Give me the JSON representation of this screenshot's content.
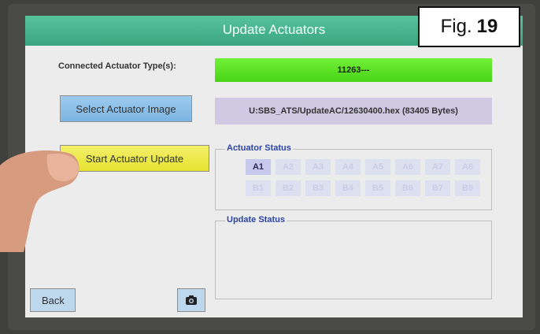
{
  "window": {
    "title": "Update Actuators"
  },
  "figure_label": {
    "prefix": "Fig.",
    "number": "19"
  },
  "connected": {
    "label": "Connected Actuator Type(s):",
    "value": "11263---"
  },
  "buttons": {
    "select_image": "Select Actuator Image",
    "start_update": "Start Actuator Update",
    "back": "Back",
    "camera_icon": "camera-icon"
  },
  "file": {
    "value": "U:SBS_ATS/UpdateAC/12630400.hex  (83405 Bytes)"
  },
  "actuator_status": {
    "title": "Actuator Status",
    "chips": [
      "A1",
      "A2",
      "A3",
      "A4",
      "A5",
      "A6",
      "A7",
      "A8",
      "B1",
      "B2",
      "B3",
      "B4",
      "B5",
      "B6",
      "B7",
      "B8"
    ],
    "active": "A1"
  },
  "update_status": {
    "title": "Update Status"
  },
  "colors": {
    "titlebar": "#3aa680",
    "type_field": "#48d516",
    "select_button": "#7cb5e4",
    "start_button": "#e7e32f",
    "file_field": "#cfc9e3"
  }
}
